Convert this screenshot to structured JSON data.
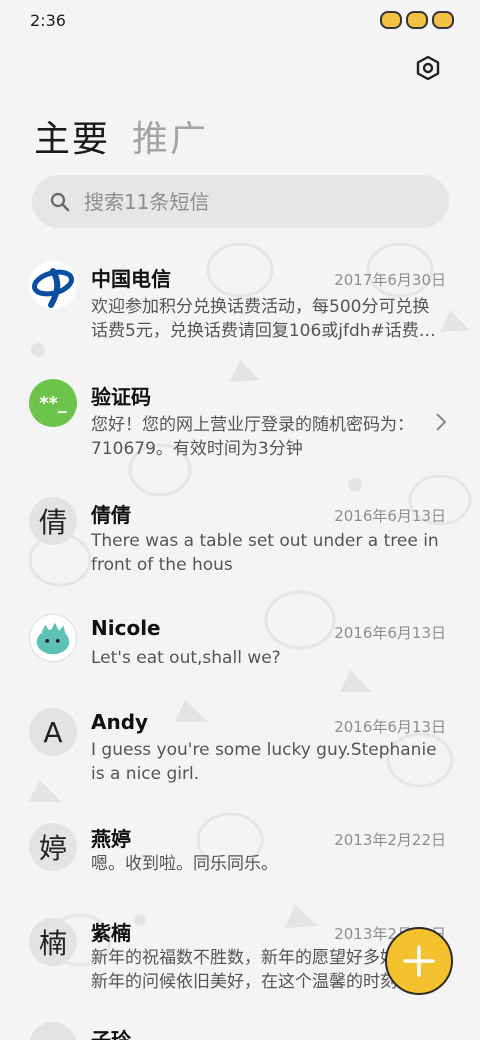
{
  "status_bar": {
    "time": "2:36"
  },
  "tabs": [
    {
      "label": "主要"
    },
    {
      "label": "推广"
    }
  ],
  "search": {
    "placeholder": "搜索11条短信"
  },
  "conversations": [
    {
      "name": "中国电信",
      "date": "2017年6月30日",
      "preview": "欢迎参加积分兑换话费活动，每500分可兑换话费5元，兑换话费请回复106或jfdh#话费…",
      "avatar": "china-telecom-logo-icon"
    },
    {
      "name": "验证码",
      "date": "",
      "preview": "您好！您的网上营业厅登录的随机密码为：710679。有效时间为3分钟",
      "avatar_text": "**_"
    },
    {
      "name": "倩倩",
      "date": "2016年6月13日",
      "preview": "There was a table set out under a tree in front of the hous",
      "avatar_text": "倩"
    },
    {
      "name": "Nicole",
      "date": "2016年6月13日",
      "preview": "Let's eat out,shall we?",
      "avatar": "cartoon-avatar-icon"
    },
    {
      "name": "Andy",
      "date": "2016年6月13日",
      "preview": "I guess you're some lucky guy.Stephanie is a nice girl.",
      "avatar_text": "A"
    },
    {
      "name": "燕婷",
      "date": "2013年2月22日",
      "preview": "嗯。收到啦。同乐同乐。",
      "avatar_text": "婷"
    },
    {
      "name": "紫楠",
      "date": "2013年2月22日",
      "preview": "新年的祝福数不胜数，新年的愿望好多好多，新年的问候依旧美好，在这个温馨的时刻",
      "avatar_text": "楠"
    },
    {
      "name": "子玲",
      "date": "",
      "preview": ""
    }
  ],
  "colors": {
    "accent": "#f3c12d",
    "verify_avatar": "#6cc44b",
    "telecom_blue": "#0a4ea2"
  }
}
